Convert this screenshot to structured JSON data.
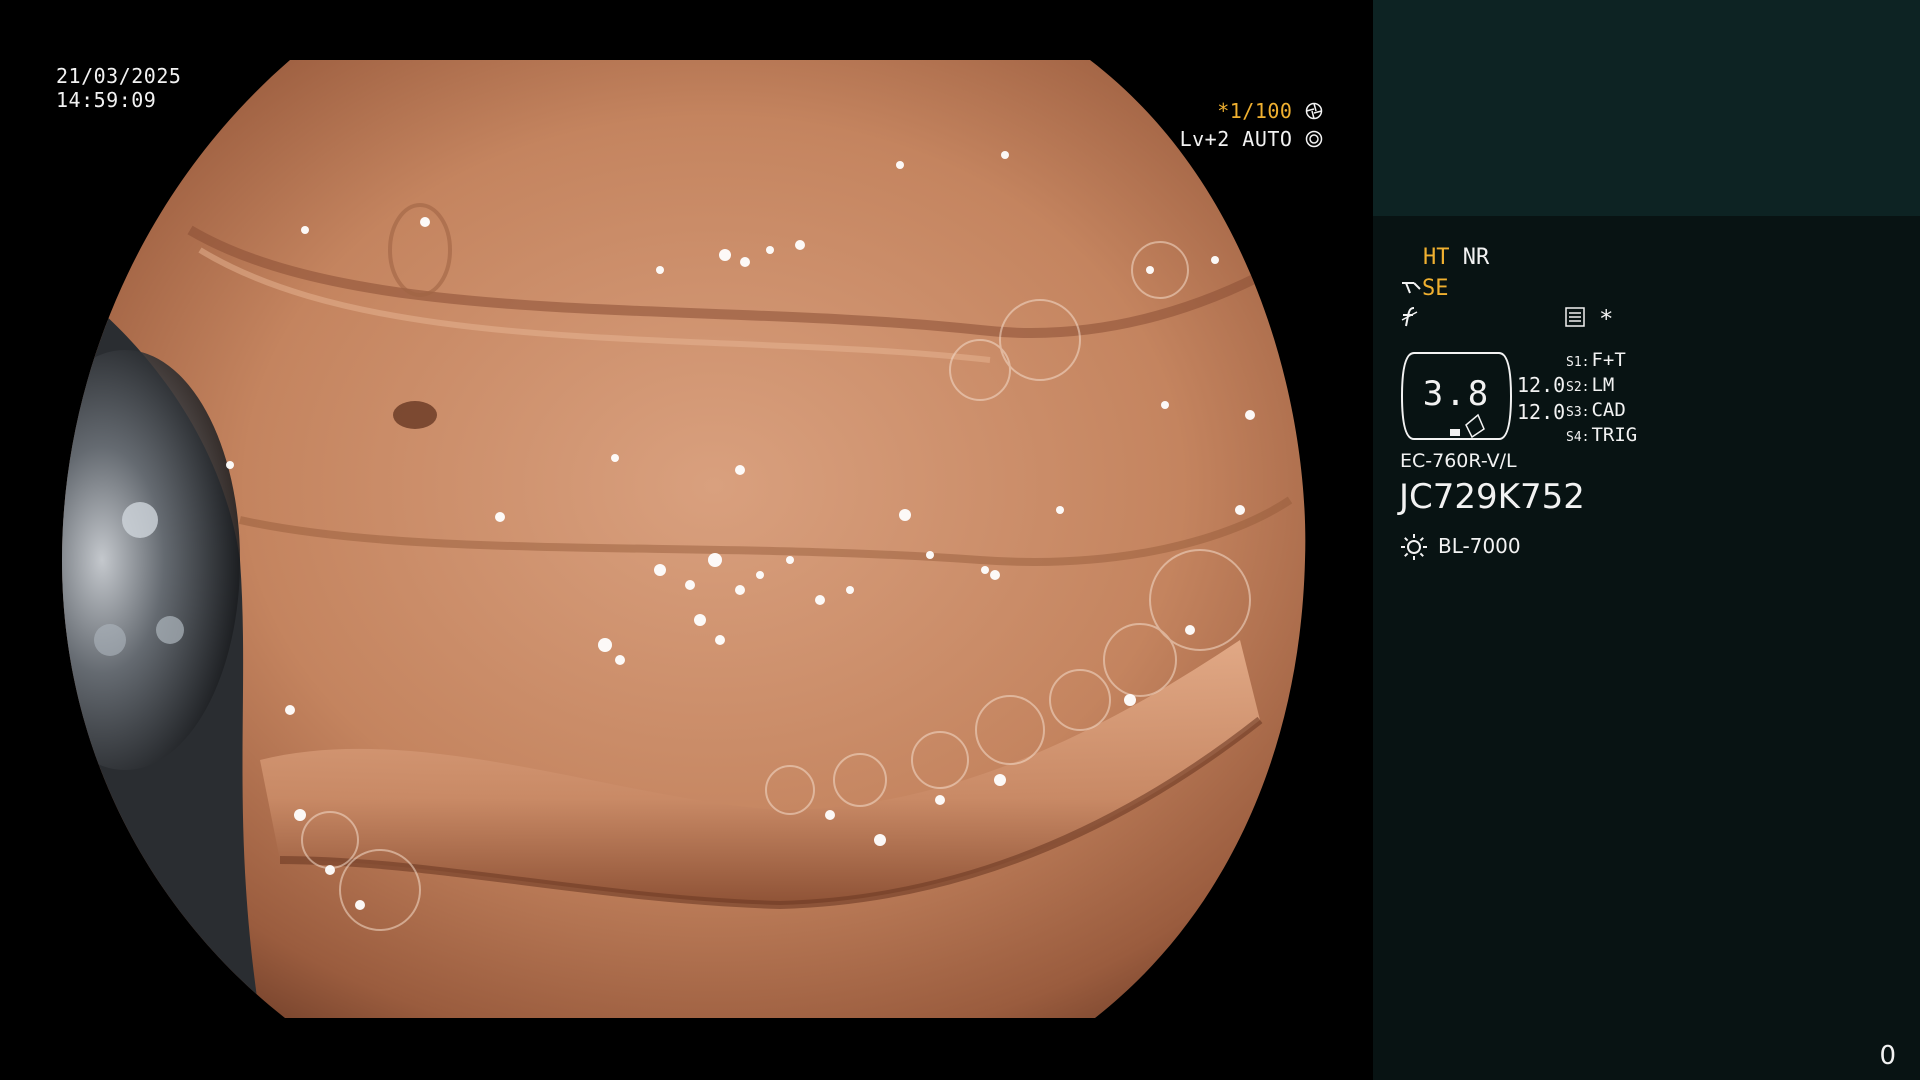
{
  "overlay": {
    "date": "21/03/2025",
    "time": "14:59:09",
    "shutter_star": "*",
    "shutter_value": "1/100",
    "shutter_icon": "aperture-icon",
    "iris_label": "Lv+2 AUTO",
    "iris_icon": "iris-icon"
  },
  "panel": {
    "ht_label": "HT",
    "nr_label": "NR",
    "se_label": "SE",
    "filter_icon": "filter-menu-icon",
    "star_label": "*",
    "magnification": "3.8",
    "value_1": "12.0",
    "value_2": "12.0",
    "scope_switches": [
      {
        "key": "S1:",
        "value": "F+T"
      },
      {
        "key": "S2:",
        "value": "LM"
      },
      {
        "key": "S3:",
        "value": "CAD"
      },
      {
        "key": "S4:",
        "value": "TRIG"
      }
    ],
    "scope_model": "EC-760R-V/L",
    "serial_number": "JC729K752",
    "light_icon": "sun-icon",
    "light_source": "BL-7000",
    "counter": "0"
  },
  "colors": {
    "background": "#000000",
    "panel_bg": "#081313",
    "panel_top_bg": "#0d2323",
    "accent_orange": "#f0b030",
    "text": "#f2f2f2",
    "tissue_base": "#c98a68",
    "tissue_dark": "#8a4e34"
  }
}
